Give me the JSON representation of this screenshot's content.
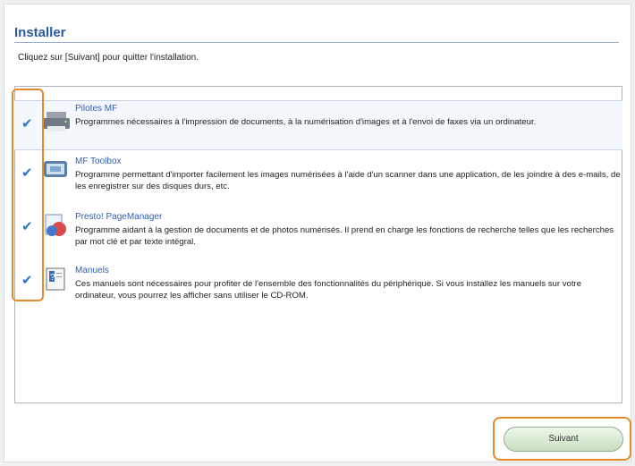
{
  "installer": {
    "title": "Installer",
    "instruction": "Cliquez sur [Suivant] pour quitter l'installation."
  },
  "items": [
    {
      "title": "Pilotes MF",
      "description": "Programmes nécessaires à l'impression de documents, à la numérisation d'images et à l'envoi de faxes via un ordinateur.",
      "icon": "printer-icon",
      "checked": true
    },
    {
      "title": "MF Toolbox",
      "description": "Programme permettant d'importer facilement les images numérisées à l'aide d'un scanner dans une application, de les joindre à des e-mails, de les enregistrer sur des disques durs, etc.",
      "icon": "toolbox-icon",
      "checked": true
    },
    {
      "title": "Presto! PageManager",
      "description": "Programme aidant à la gestion de documents et de photos numérisés. Il prend en charge les fonctions de recherche telles que les recherches par mot clé et par texte intégral.",
      "icon": "pagemanager-icon",
      "checked": true
    },
    {
      "title": "Manuels",
      "description": "Ces manuels sont nécessaires pour profiter de l'ensemble des fonctionnalités du périphérique. Si vous installez les manuels sur votre ordinateur, vous pourrez les afficher sans utiliser le CD-ROM.",
      "icon": "manuals-icon",
      "checked": true
    }
  ],
  "footer": {
    "next_label": "Suivant"
  },
  "colors": {
    "accent": "#2c5aa0",
    "highlight": "#e38a2d",
    "check": "#2f75c9"
  }
}
